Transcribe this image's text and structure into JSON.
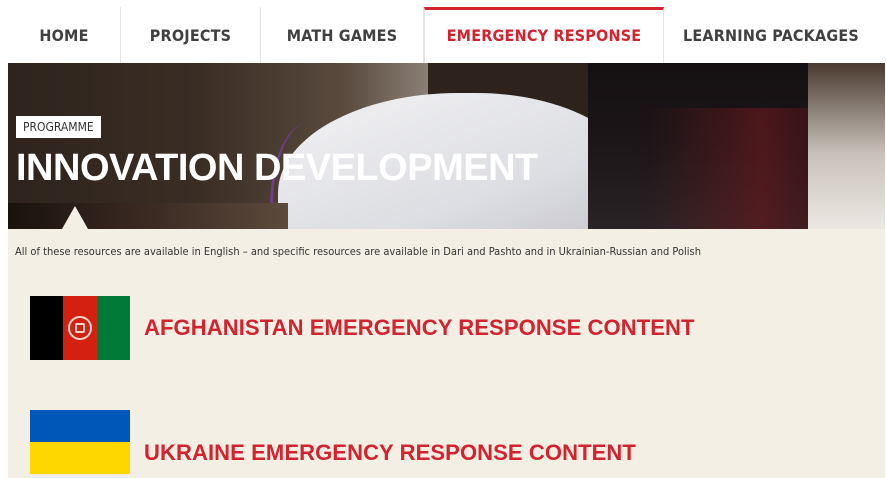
{
  "nav": {
    "items": [
      {
        "label": "HOME"
      },
      {
        "label": "PROJECTS"
      },
      {
        "label": "MATH GAMES"
      },
      {
        "label": "EMERGENCY RESPONSE"
      },
      {
        "label": "LEARNING PACKAGES"
      }
    ],
    "active_index": 3
  },
  "hero": {
    "tag": "PROGRAMME",
    "title": "INNOVATION DEVELOPMENT"
  },
  "content": {
    "info": "All of these resources are available in English – and specific resources are available in Dari and Pashto and in Ukrainian-Russian and Polish",
    "sections": [
      {
        "title": "AFGHANISTAN EMERGENCY RESPONSE CONTENT",
        "flag_icon": "afghanistan-flag-icon"
      },
      {
        "title": "UKRAINE EMERGENCY RESPONSE CONTENT",
        "flag_icon": "ukraine-flag-icon"
      }
    ]
  },
  "colors": {
    "accent": "#d2232f",
    "content_bg": "#f3efe4",
    "nav_text": "#404040"
  }
}
